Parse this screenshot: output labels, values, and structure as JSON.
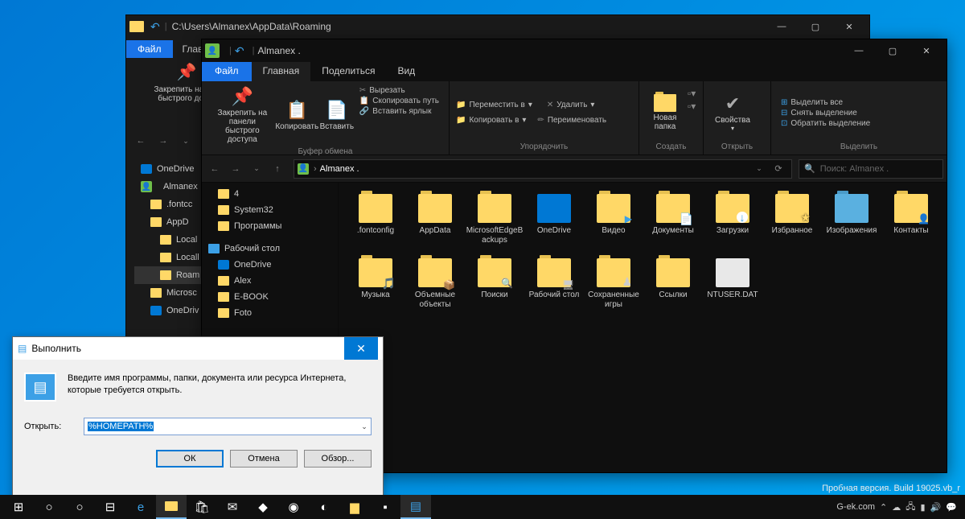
{
  "back_window": {
    "title_path": "C:\\Users\\Almanex\\AppData\\Roaming",
    "file_tab": "Файл",
    "menu_home": "Главн",
    "pin_label": "Закрепить на пан\nбыстрого досту",
    "sidebar": {
      "onedrive": "OneDrive",
      "almanex": "Almanex",
      "fontcc": ".fontcc",
      "appd": "AppD",
      "local": "Local",
      "locall": "Locall",
      "roam": "Roam",
      "microsc": "Microsc",
      "onedriv": "OneDriv"
    }
  },
  "front_window": {
    "title": "Almanex .",
    "tabs": {
      "file": "Файл",
      "home": "Главная",
      "share": "Поделиться",
      "view": "Вид"
    },
    "ribbon": {
      "pin": "Закрепить на панели\nбыстрого доступа",
      "copy": "Копировать",
      "paste": "Вставить",
      "cut": "Вырезать",
      "copy_path": "Скопировать путь",
      "paste_shortcut": "Вставить ярлык",
      "clipboard": "Буфер обмена",
      "move_to": "Переместить в",
      "copy_to": "Копировать в",
      "delete": "Удалить",
      "rename": "Переименовать",
      "organize": "Упорядочить",
      "new_folder": "Новая\nпапка",
      "create": "Создать",
      "properties": "Свойства",
      "open": "Открыть",
      "select_all": "Выделить все",
      "deselect": "Снять выделение",
      "invert": "Обратить выделение",
      "select": "Выделить"
    },
    "breadcrumb": "Almanex .",
    "search_placeholder": "Поиск: Almanex .",
    "sidebar": [
      "4",
      "System32",
      "Программы",
      "Рабочий стол",
      "OneDrive",
      "Alex",
      "E-BOOK",
      "Foto"
    ],
    "files": [
      ".fontconfig",
      "AppData",
      "MicrosoftEdgeBackups",
      "OneDrive",
      "Видео",
      "Документы",
      "Загрузки",
      "Избранное",
      "Изображения",
      "Контакты",
      "Музыка",
      "Объемные объекты",
      "Поиски",
      "Рабочий стол",
      "Сохраненные игры",
      "Ссылки",
      "NTUSER.DAT"
    ]
  },
  "run_dialog": {
    "title": "Выполнить",
    "description": "Введите имя программы, папки, документа или ресурса Интернета, которые требуется открыть.",
    "open_label": "Открыть:",
    "input_value": "%HOMEPATH%",
    "ok": "ОК",
    "cancel": "Отмена",
    "browse": "Обзор..."
  },
  "taskbar": {
    "site": "G-ek.com"
  },
  "watermark": "Пробная версия. Build 19025.vb_r"
}
